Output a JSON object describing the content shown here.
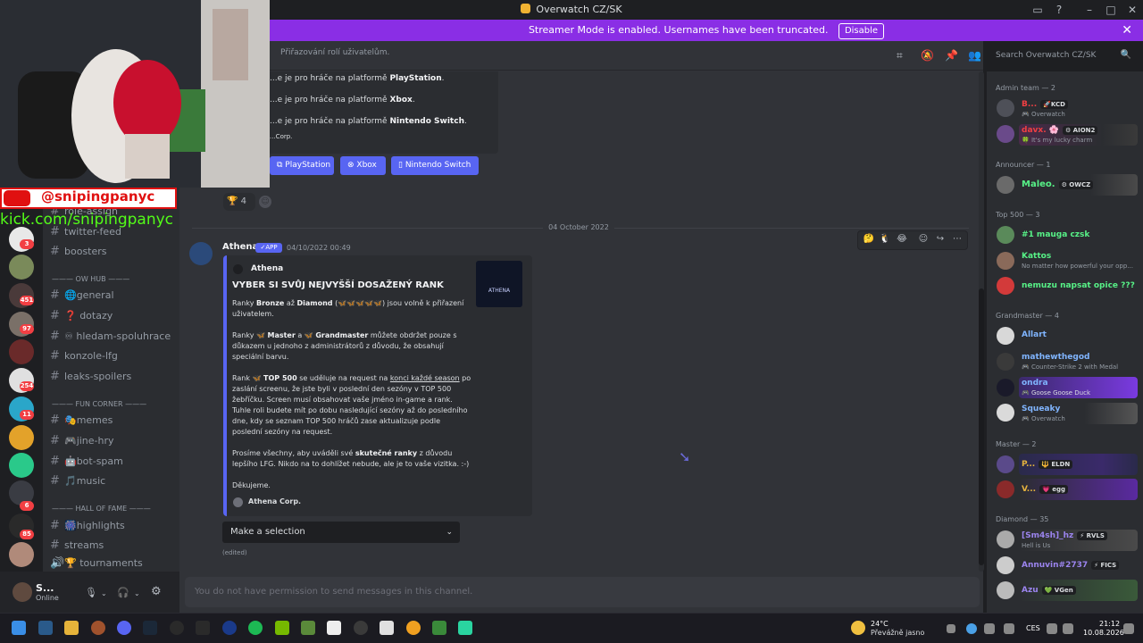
{
  "window": {
    "title": "Overwatch CZ/SK"
  },
  "banner": {
    "text": "Streamer Mode is enabled. Usernames have been truncated.",
    "disable_label": "Disable"
  },
  "overlay": {
    "youtube_handle": "@snipingpanyc",
    "kick_url": "kick.com/snipingpanyc"
  },
  "server_badges": [
    "3",
    "451",
    "97",
    "254",
    "11",
    "6",
    "85"
  ],
  "channels": {
    "items": [
      {
        "name": "role-assign",
        "type": "channel"
      },
      {
        "name": "twitter-feed",
        "type": "channel"
      },
      {
        "name": "boosters",
        "type": "channel"
      },
      {
        "name": "——— OW HUB ———",
        "type": "category"
      },
      {
        "name": "🌐general",
        "type": "channel"
      },
      {
        "name": "❓ dotazy",
        "type": "channel"
      },
      {
        "name": "♾ hledam-spoluhrace",
        "type": "channel"
      },
      {
        "name": "konzole-lfg",
        "type": "channel"
      },
      {
        "name": "leaks-spoilers",
        "type": "channel"
      },
      {
        "name": "——— FUN CORNER ———",
        "type": "category"
      },
      {
        "name": "🎭memes",
        "type": "channel"
      },
      {
        "name": "🎮jine-hry",
        "type": "channel"
      },
      {
        "name": "🤖bot-spam",
        "type": "channel"
      },
      {
        "name": "🎵music",
        "type": "channel"
      },
      {
        "name": "——— HALL OF FAME ———",
        "type": "category"
      },
      {
        "name": "🎆highlights",
        "type": "channel"
      },
      {
        "name": "streams",
        "type": "channel"
      },
      {
        "name": "🏆 tournaments",
        "type": "channel"
      }
    ]
  },
  "user": {
    "name": "S...",
    "status": "Online"
  },
  "header": {
    "description": "Přiřazování rolí uživatelům.",
    "search_placeholder": "Search Overwatch CZ/SK"
  },
  "embed_top": {
    "lines": [
      {
        "prefix": "...e je pro hráče na platformě ",
        "bold": "PlayStation",
        "suffix": "."
      },
      {
        "prefix": "...e je pro hráče na platformě ",
        "bold": "Xbox",
        "suffix": "."
      },
      {
        "prefix": "...e je pro hráče na platformě ",
        "bold": "Nintendo Switch",
        "suffix": "."
      }
    ],
    "footer": "...Corp."
  },
  "platform_buttons": [
    "PlayStation",
    "Xbox",
    "Nintendo Switch"
  ],
  "reaction": {
    "count": "4"
  },
  "date_divider": "04 October 2022",
  "message": {
    "author": "Athena",
    "tag": "APP",
    "timestamp": "04/10/2022 00:49",
    "embed": {
      "author": "Athena",
      "thumbnail_text": "ATHENA",
      "title": "VYBER SI SVŮJ NEJVYŠŠÍ DOSAŽENÝ RANK",
      "p1": {
        "a": "Ranky ",
        "b1": "Bronze",
        "c": " až ",
        "b2": "Diamond",
        "d": " (🦋🦋🦋🦋🦋) jsou volně k přiřazení uživatelem."
      },
      "p2": {
        "a": "Ranky 🦋 ",
        "b1": "Master",
        "c": " a 🦋 ",
        "b2": "Grandmaster",
        "d": " můžete obdržet pouze s důkazem u jednoho z administrátorů z důvodu, že obsahují speciální barvu."
      },
      "p3": {
        "a": "Rank 🦋 ",
        "b1": "TOP 500",
        "c": " se uděluje na request na ",
        "link": "konci každé season",
        "d": " po zaslání screenu, že jste byli v poslední den sezóny v TOP 500 žebříčku. Screen musí obsahovat vaše jméno in-game a rank. Tuhle roli budete mít po dobu nasledující sezóny až do posledního dne, kdy se seznam TOP 500 hráčů zase aktualizuje podle poslední sezóny na request."
      },
      "p4": {
        "a": "Prosíme všechny, aby uváděli své ",
        "b1": "skutečné ranky",
        "d": " z důvodu lepšího LFG. Nikdo na to dohlížet nebude, ale je to vaše vizitka. :-)"
      },
      "p5": "Děkujeme.",
      "footer": "Athena Corp."
    },
    "select_placeholder": "Make a selection",
    "edited": "(edited)"
  },
  "composer": {
    "placeholder": "You do not have permission to send messages in this channel."
  },
  "members": {
    "groups": [
      {
        "title": "Admin team — 2",
        "members": [
          {
            "name": "B...",
            "tag": "🚀KCD",
            "sub": "🎮 Overwatch",
            "color": "#f23f43"
          },
          {
            "name": "davx. 🌸",
            "tag": "⚙ AION2",
            "sub": "🍀 It's my lucky charm",
            "color": "#f23f43"
          }
        ]
      },
      {
        "title": "Announcer — 1",
        "members": [
          {
            "name": "Maleo.",
            "tag": "⚙ OWCZ",
            "sub": "",
            "color": "#57f287"
          }
        ]
      },
      {
        "title": "Top 500 — 3",
        "members": [
          {
            "name": "#1 mauga czsk",
            "tag": "",
            "sub": "",
            "color": "#57f287"
          },
          {
            "name": "Kattos",
            "tag": "",
            "sub": "No matter how powerful your opp...",
            "color": "#57f287"
          },
          {
            "name": "nemuzu napsat opice ???",
            "tag": "",
            "sub": "",
            "color": "#57f287"
          }
        ]
      },
      {
        "title": "Grandmaster — 4",
        "members": [
          {
            "name": "Allart",
            "tag": "",
            "sub": "",
            "color": "#80b5ff"
          },
          {
            "name": "mathewthegod",
            "tag": "",
            "sub": "🎮 Counter-Strike 2 with Medal",
            "color": "#80b5ff"
          },
          {
            "name": "ondra",
            "tag": "",
            "sub": "🎮 Goose Goose Duck",
            "color": "#80b5ff"
          },
          {
            "name": "Squeaky",
            "tag": "",
            "sub": "🎮 Overwatch",
            "color": "#80b5ff"
          }
        ]
      },
      {
        "title": "Master — 2",
        "members": [
          {
            "name": "P...",
            "tag": "🔱 ELDN",
            "sub": "",
            "color": "#e5b33e"
          },
          {
            "name": "V...",
            "tag": "💗 egg",
            "sub": "",
            "color": "#e5b33e"
          }
        ]
      },
      {
        "title": "Diamond — 35",
        "members": [
          {
            "name": "[Sm4sh]_hz",
            "tag": "⚡ RVLS",
            "sub": "Hell is Us",
            "color": "#9b84ee"
          },
          {
            "name": "Annuvin#2737",
            "tag": "⚡ FICS",
            "sub": "",
            "color": "#9b84ee"
          },
          {
            "name": "Azu",
            "tag": "💚 VGen",
            "sub": "",
            "color": "#9b84ee"
          }
        ]
      }
    ]
  },
  "taskbar": {
    "weather_temp": "24°C",
    "weather_desc": "Převážně jasno",
    "language": "CES",
    "time": "21:12",
    "date": "10.08.2026"
  }
}
